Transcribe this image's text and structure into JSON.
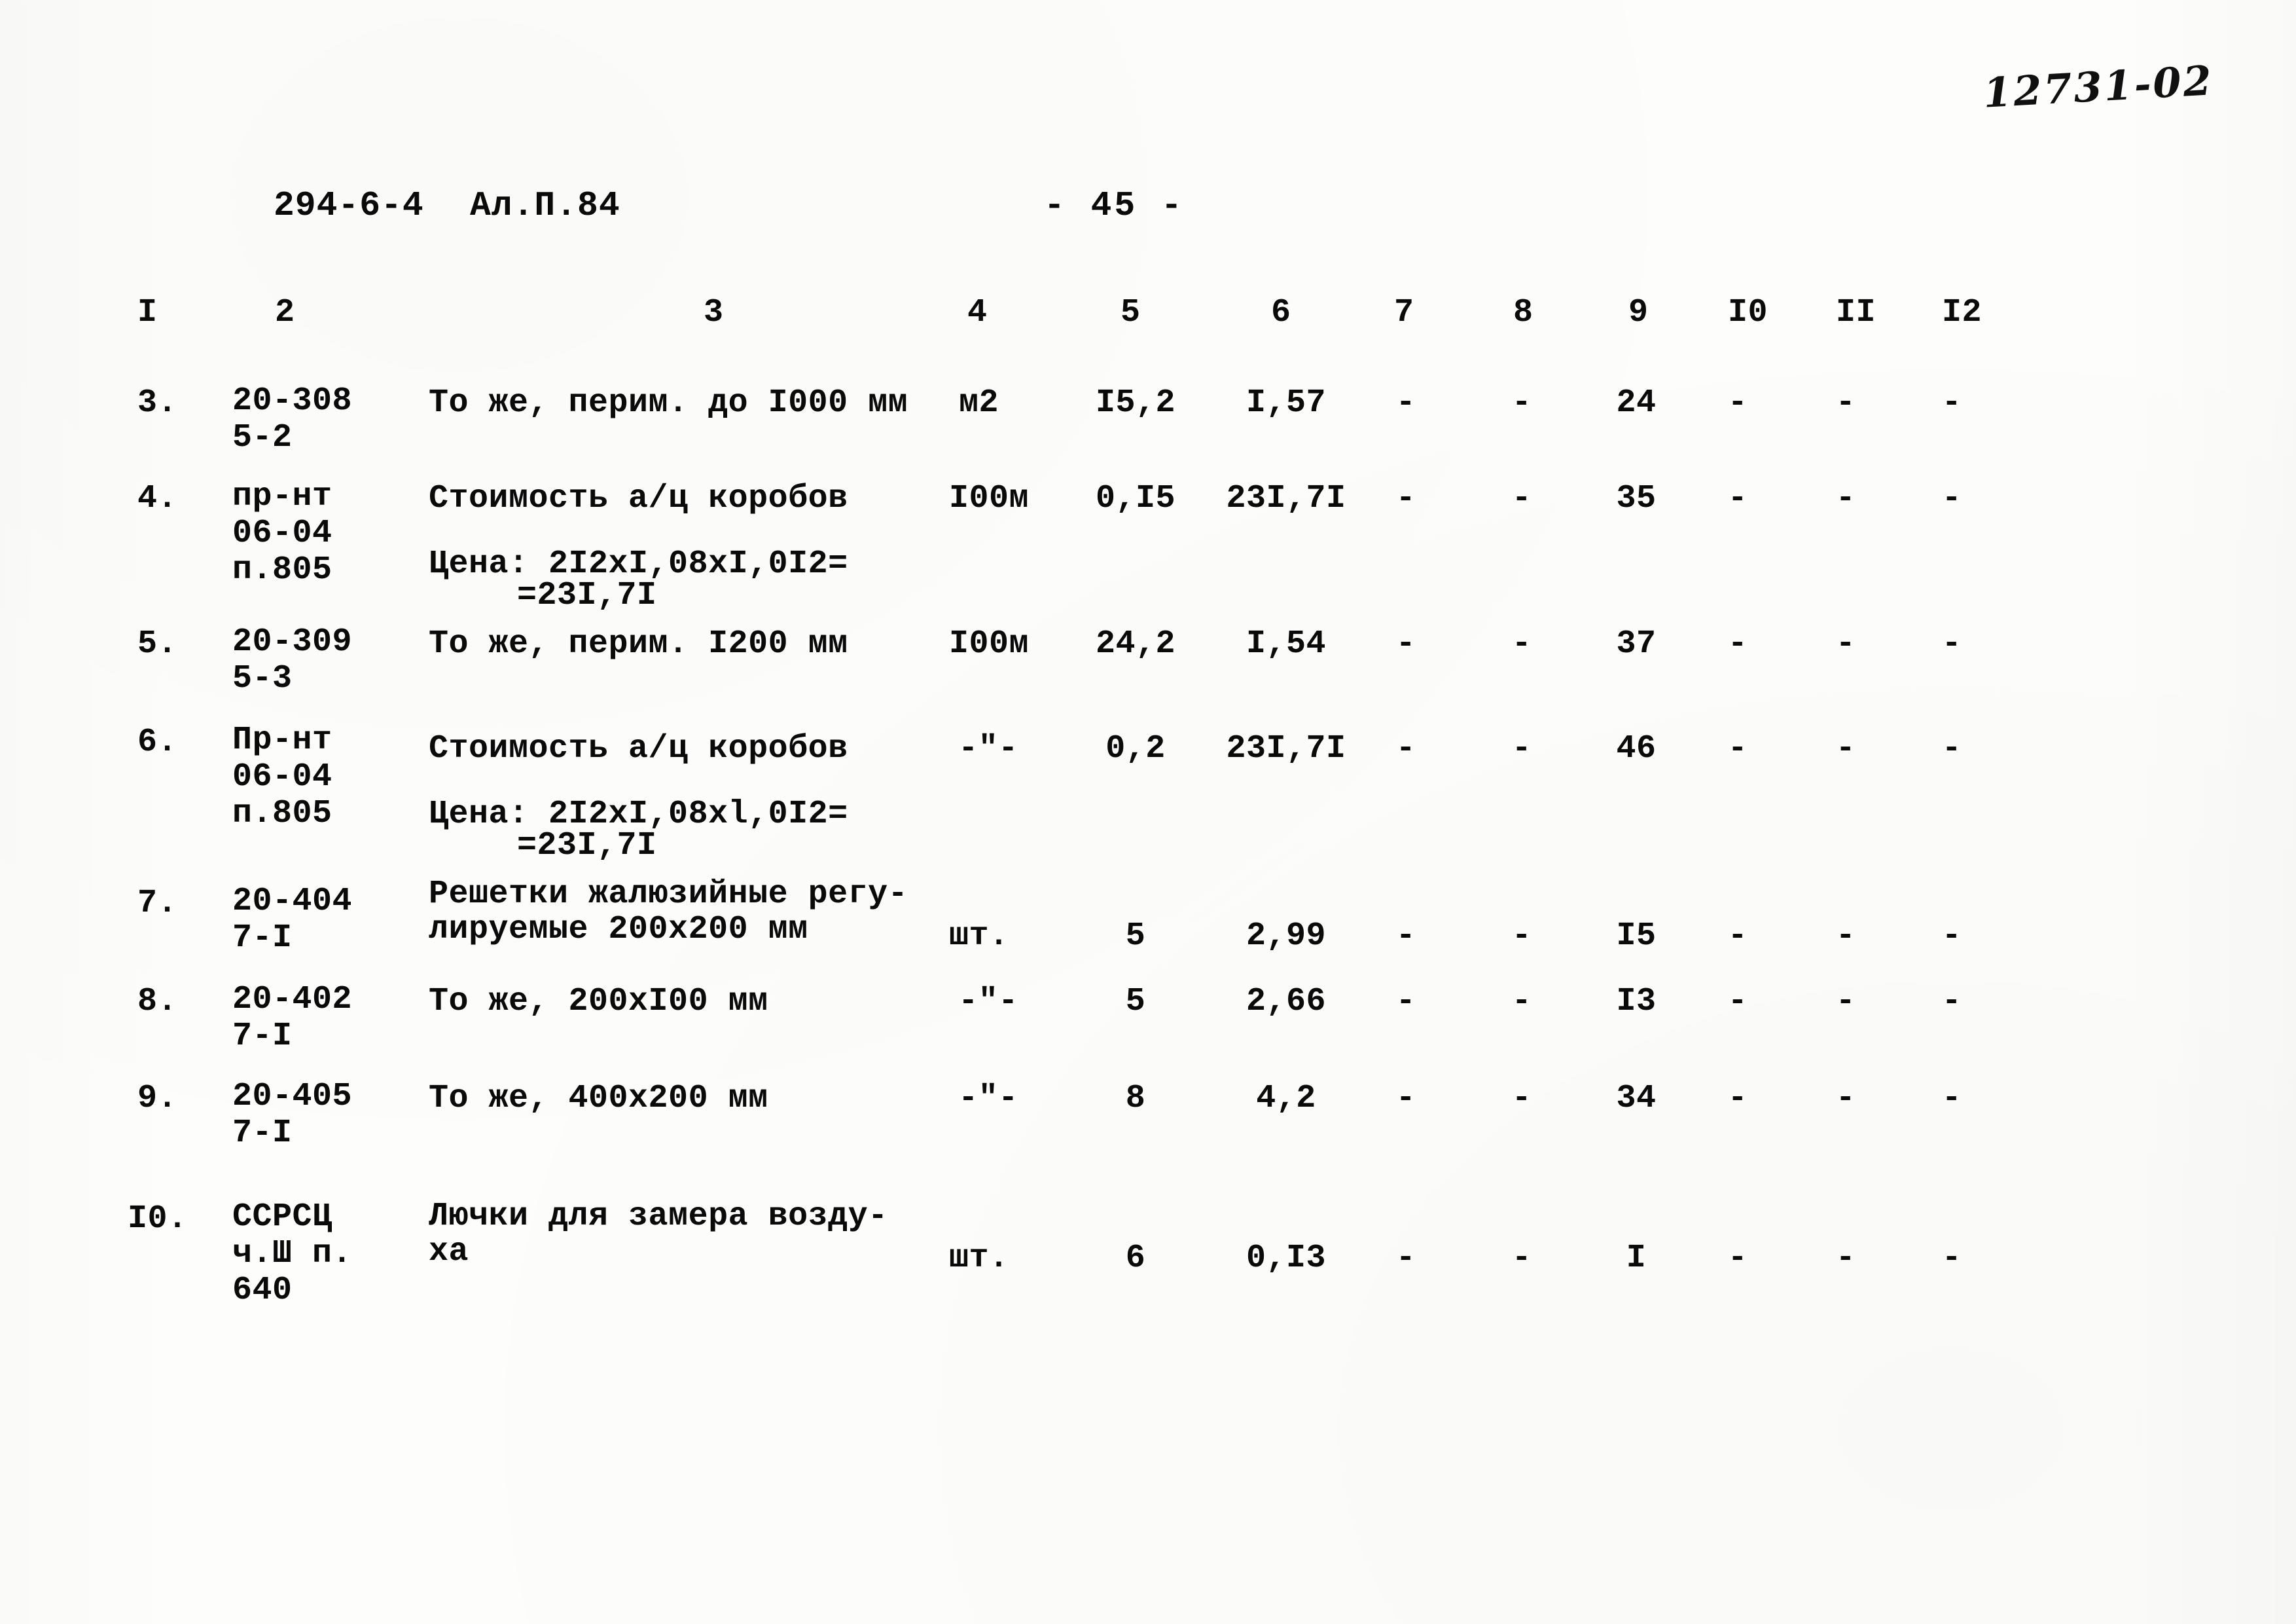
{
  "handwritten_note": "12731-02",
  "header": {
    "document_code": "294-6-4",
    "album": "Ал.П.84",
    "page_marker": "- 45 -"
  },
  "table": {
    "column_headers": [
      "I",
      "2",
      "3",
      "4",
      "5",
      "6",
      "7",
      "8",
      "9",
      "I0",
      "II",
      "I2"
    ],
    "rows": [
      {
        "num": "3.",
        "code_line1": "20-308",
        "code_line2": "5-2",
        "desc_line1": "То же, перим. до I000 мм",
        "desc_line2": "",
        "desc_line3": "",
        "unit": "м2",
        "c5": "I5,2",
        "c6": "I,57",
        "c7": "-",
        "c8": "-",
        "c9": "24",
        "c10": "-",
        "c11": "-",
        "c12": "-"
      },
      {
        "num": "4.",
        "code_line1": "пр-нт",
        "code_line2": "06-04",
        "code_line3": "п.805",
        "desc_line1": "Стоимость а/ц коробов",
        "desc_line2": "Цена: 2I2xI,08xI,0I2=",
        "desc_line3": "=23I,7I",
        "unit": "I00м",
        "c5": "0,I5",
        "c6": "23I,7I",
        "c7": "-",
        "c8": "-",
        "c9": "35",
        "c10": "-",
        "c11": "-",
        "c12": "-"
      },
      {
        "num": "5.",
        "code_line1": "20-309",
        "code_line2": "5-3",
        "desc_line1": "То же, перим. I200 мм",
        "desc_line2": "",
        "desc_line3": "",
        "unit": "I00м",
        "c5": "24,2",
        "c6": "I,54",
        "c7": "-",
        "c8": "-",
        "c9": "37",
        "c10": "-",
        "c11": "-",
        "c12": "-"
      },
      {
        "num": "6.",
        "code_line1": "Пр-нт",
        "code_line2": "06-04",
        "code_line3": "п.805",
        "desc_line1": "Стоимость а/ц коробов",
        "desc_line2": "Цена: 2I2xI,08xl,0I2=",
        "desc_line3": "=23I,7I",
        "unit": "-\"-",
        "c5": "0,2",
        "c6": "23I,7I",
        "c7": "-",
        "c8": "-",
        "c9": "46",
        "c10": "-",
        "c11": "-",
        "c12": "-"
      },
      {
        "num": "7.",
        "code_line1": "20-404",
        "code_line2": "7-I",
        "desc_line1": "Решетки жалюзийные регу-",
        "desc_line2": "лируемые 200x200 мм",
        "desc_line3": "",
        "unit": "шт.",
        "c5": "5",
        "c6": "2,99",
        "c7": "-",
        "c8": "-",
        "c9": "I5",
        "c10": "-",
        "c11": "-",
        "c12": "-"
      },
      {
        "num": "8.",
        "code_line1": "20-402",
        "code_line2": "7-I",
        "desc_line1": "То же, 200xI00 мм",
        "desc_line2": "",
        "desc_line3": "",
        "unit": "-\"-",
        "c5": "5",
        "c6": "2,66",
        "c7": "-",
        "c8": "-",
        "c9": "I3",
        "c10": "-",
        "c11": "-",
        "c12": "-"
      },
      {
        "num": "9.",
        "code_line1": "20-405",
        "code_line2": "7-I",
        "desc_line1": "То же, 400x200 мм",
        "desc_line2": "",
        "desc_line3": "",
        "unit": "-\"-",
        "c5": "8",
        "c6": "4,2",
        "c7": "-",
        "c8": "-",
        "c9": "34",
        "c10": "-",
        "c11": "-",
        "c12": "-"
      },
      {
        "num": "I0.",
        "code_line1": "ССРСЦ",
        "code_line2": "ч.Ш п.",
        "code_line3": "640",
        "desc_line1": "Лючки для замера возду-",
        "desc_line2": "ха",
        "desc_line3": "",
        "unit": "шт.",
        "c5": "6",
        "c6": "0,I3",
        "c7": "-",
        "c8": "-",
        "c9": "I",
        "c10": "-",
        "c11": "-",
        "c12": "-"
      }
    ]
  }
}
